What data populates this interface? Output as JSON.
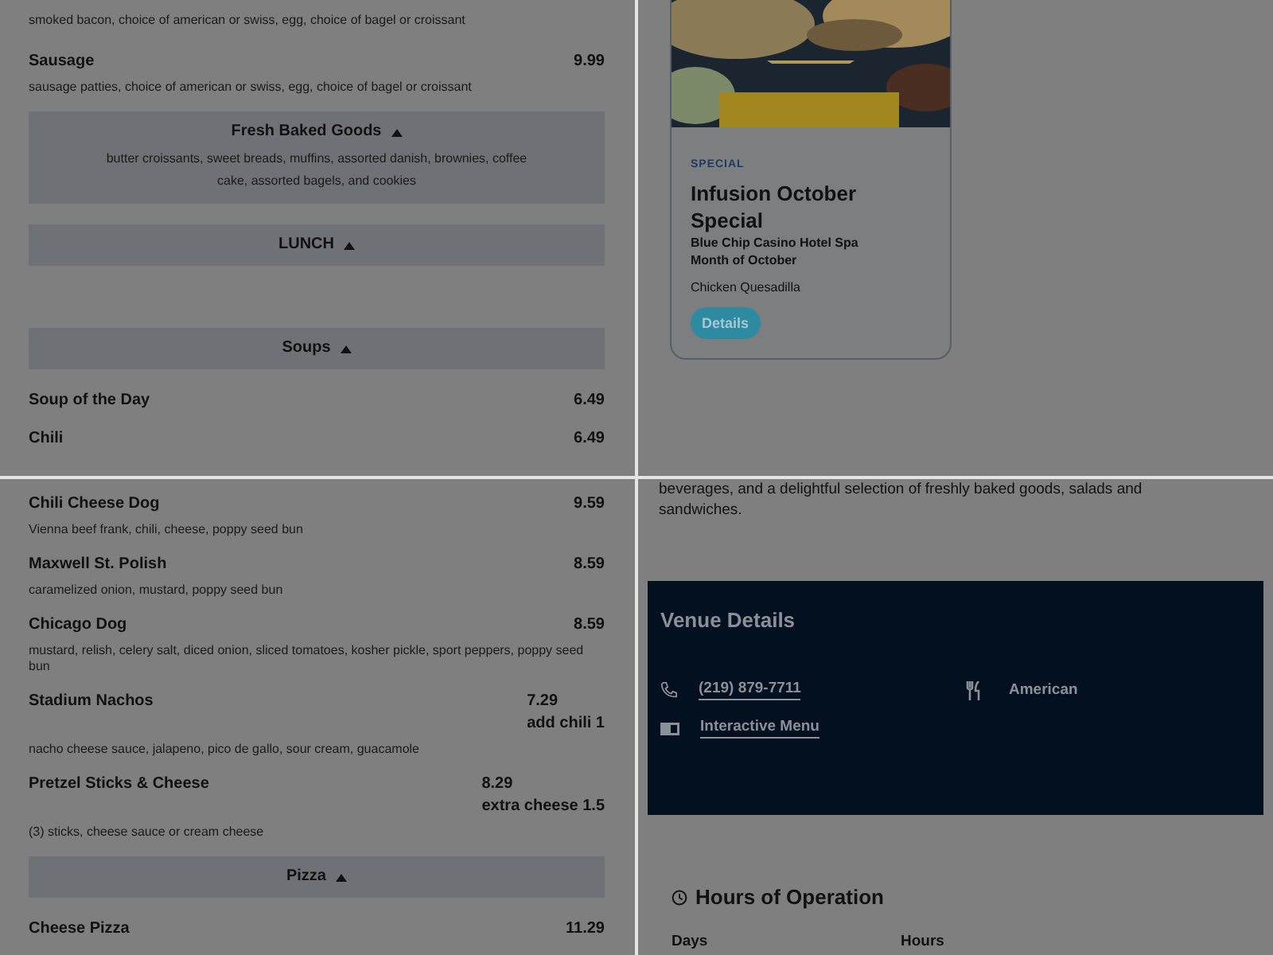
{
  "breakfast_panel": {
    "rows": [
      {
        "kind": "note",
        "text": "smoked bacon, choice of american or swiss, egg, choice of bagel or croissant"
      },
      {
        "kind": "item",
        "name": "Sausage",
        "price": "9.99",
        "description": "sausage patties, choice of american or swiss, egg, choice of bagel or croissant"
      },
      {
        "kind": "section",
        "title": "Fresh Baked Goods",
        "expanded": true,
        "note": "butter croissants, sweet breads, muffins, assorted danish, brownies, coffee cake, assorted bagels, and cookies"
      },
      {
        "kind": "category",
        "title": "LUNCH",
        "expanded": true
      },
      {
        "kind": "section",
        "title": "Soups",
        "expanded": true
      },
      {
        "kind": "item",
        "name": "Soup of the Day",
        "price": "6.49"
      },
      {
        "kind": "item",
        "name": "Chili",
        "price": "6.49"
      }
    ]
  },
  "special_card": {
    "tag": "SPECIAL",
    "title": "Infusion October Special",
    "venue": "Blue Chip Casino Hotel Spa",
    "period": "Month of October",
    "dish": "Chicken Quesadilla",
    "button": "Details"
  },
  "lunch_panel": {
    "rows": [
      {
        "kind": "item",
        "name": "Chili Cheese Dog",
        "price": "9.59",
        "description": "Vienna beef frank, chili, cheese, poppy seed bun"
      },
      {
        "kind": "item",
        "name": "Maxwell St. Polish",
        "price": "8.59",
        "description": "caramelized onion, mustard, poppy seed bun"
      },
      {
        "kind": "item",
        "name": "Chicago Dog",
        "price": "8.59",
        "description": "mustard, relish, celery salt, diced onion, sliced tomatoes, kosher pickle, sport peppers, poppy seed bun"
      },
      {
        "kind": "item",
        "name": "Stadium Nachos",
        "price": "7.29",
        "extra": "add chili 1",
        "description": "nacho cheese sauce, jalapeno, pico de gallo, sour cream, guacamole"
      },
      {
        "kind": "item",
        "name": "Pretzel Sticks & Cheese",
        "price": "8.29",
        "extra": "extra cheese 1.5",
        "description": "(3) sticks, cheese sauce or cream cheese"
      },
      {
        "kind": "section",
        "title": "Pizza",
        "expanded": true
      },
      {
        "kind": "item",
        "name": "Cheese Pizza",
        "price": "11.29"
      }
    ]
  },
  "venue_panel": {
    "intro": "beverages, and a delightful selection of freshly baked goods, salads and sandwiches.",
    "venue_details": {
      "title": "Venue Details",
      "phone": "(219) 879-7711",
      "cuisine": "American",
      "menu_link": "Interactive Menu"
    },
    "hours": {
      "title": "Hours of Operation",
      "columns": [
        "Days",
        "Hours"
      ]
    }
  }
}
